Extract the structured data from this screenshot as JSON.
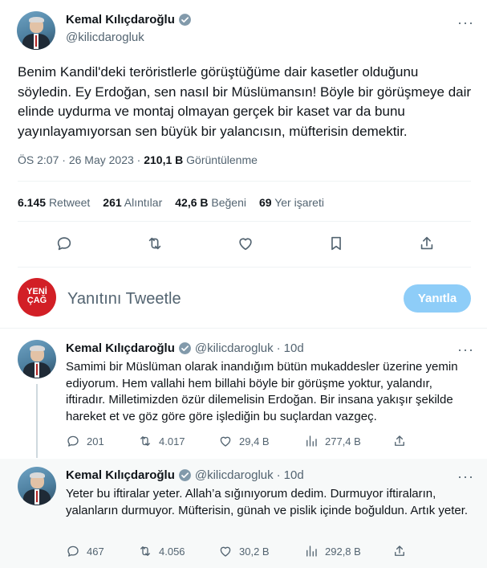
{
  "main_tweet": {
    "author_name": "Kemal Kılıçdaroğlu",
    "handle": "@kilicdarogluk",
    "more_label": "···",
    "text": "Benim Kandil'deki teröristlerle görüştüğüme dair kasetler olduğunu söyledin. Ey Erdoğan, sen nasıl bir Müslümansın! Böyle bir görüşmeye dair elinde uydurma ve montaj olmayan gerçek bir kaset var da bunu yayınlayamıyorsan sen büyük bir yalancısın, müfterisin demektir.",
    "time": "ÖS 2:07",
    "date": "26 May 2023",
    "views_count": "210,1 B",
    "views_label": "Görüntülenme",
    "stats": {
      "retweet_count": "6.145",
      "retweet_label": "Retweet",
      "quote_count": "261",
      "quote_label": "Alıntılar",
      "like_count": "42,6 B",
      "like_label": "Beğeni",
      "bookmark_count": "69",
      "bookmark_label": "Yer işareti"
    },
    "action_icons": [
      "reply-icon",
      "retweet-icon",
      "like-icon",
      "bookmark-icon",
      "share-icon"
    ]
  },
  "composer": {
    "avatar_text_line1": "YENİ",
    "avatar_text_line2": "ÇAĞ",
    "placeholder": "Yanıtını Tweetle",
    "reply_button": "Yanıtla",
    "reply_button_color": "#8ecdf8"
  },
  "replies": [
    {
      "author_name": "Kemal Kılıçdaroğlu",
      "handle": "@kilicdarogluk",
      "age": "10d",
      "text": "Samimi bir Müslüman olarak inandığım bütün mukaddesler üzerine yemin ediyorum. Hem vallahi hem billahi böyle bir görüşme yoktur, yalandır, iftiradır. Milletimizden özür dilemelisin Erdoğan. Bir insana yakışır şekilde hareket et ve göz göre göre işlediğin bu suçlardan vazgeç.",
      "replies": "201",
      "retweets": "4.017",
      "likes": "29,4 B",
      "views": "277,4 B"
    },
    {
      "author_name": "Kemal Kılıçdaroğlu",
      "handle": "@kilicdarogluk",
      "age": "10d",
      "text": "Yeter bu iftiralar yeter. Allah’a sığınıyorum dedim. Durmuyor iftiraların, yalanların durmuyor. Müfterisin, günah ve pislik içinde boğuldun. Artık yeter.",
      "replies": "467",
      "retweets": "4.056",
      "likes": "30,2 B",
      "views": "292,8 B"
    }
  ],
  "colors": {
    "accent": "#1d9bf0",
    "secondary_text": "#536471",
    "primary_text": "#0f1419",
    "divider": "#eff3f4",
    "hover_bg": "#f7f9f9"
  }
}
